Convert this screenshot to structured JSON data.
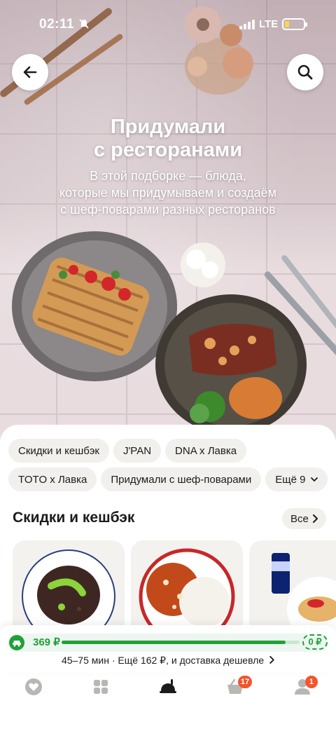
{
  "status_bar": {
    "time": "02:11",
    "network": "LTE"
  },
  "hero": {
    "title_line1": "Придумали",
    "title_line2": "с ресторанами",
    "subtitle_line1": "В этой подборке — блюда,",
    "subtitle_line2": "которые мы придумываем и создаём",
    "subtitle_line3": "с шеф-поварами разных ресторанов",
    "back_icon": "arrow-left-icon",
    "search_icon": "search-icon"
  },
  "chips": {
    "row1": [
      {
        "label": "Скидки и кешбэк"
      },
      {
        "label": "J'PAN"
      },
      {
        "label": "DNA x Лавка"
      }
    ],
    "row2": [
      {
        "label": "TOTO x Лавка"
      },
      {
        "label": "Придумали с шеф-поварами"
      },
      {
        "label": "Ещё 9"
      }
    ]
  },
  "section": {
    "title": "Скидки и кешбэк",
    "all_label": "Все"
  },
  "cart": {
    "amount": "369 ₽",
    "end_amount": "0 ₽",
    "progress": 0.94,
    "delivery_text": "45–75 мин  · Ещё 162 ₽, и доставка дешевле"
  },
  "tabbar": {
    "tabs": [
      {
        "name": "favorites",
        "icon": "heart-icon"
      },
      {
        "name": "catalog",
        "icon": "grid-icon"
      },
      {
        "name": "restaurants",
        "icon": "cloche-icon",
        "active": true
      },
      {
        "name": "cart",
        "icon": "basket-icon",
        "badge": "17"
      },
      {
        "name": "profile",
        "icon": "profile-icon",
        "badge": "1"
      }
    ]
  },
  "colors": {
    "accent_green": "#21a038",
    "badge_orange": "#f2552c",
    "chip_bg": "#f1f0ed"
  }
}
